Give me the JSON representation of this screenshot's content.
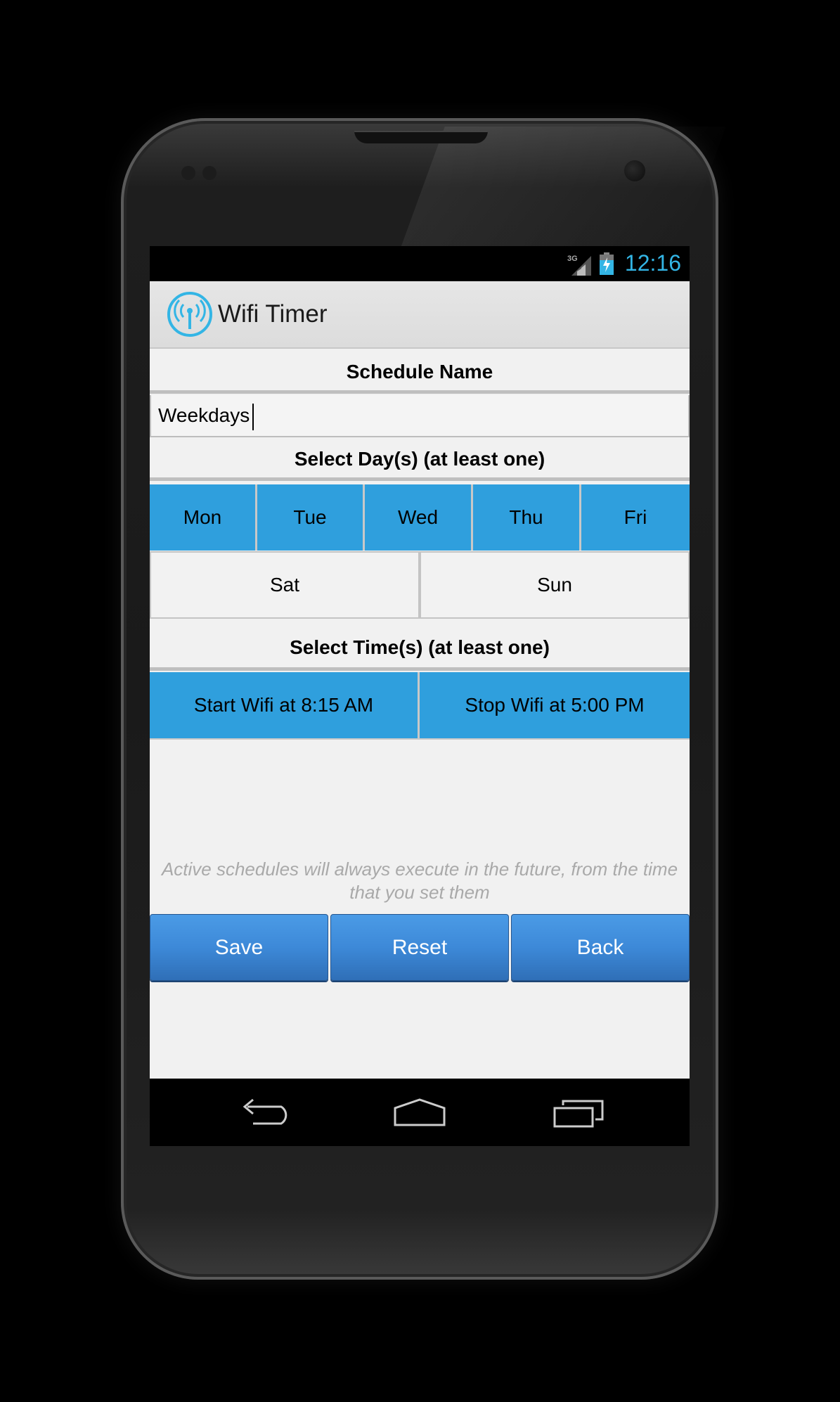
{
  "status_bar": {
    "network": "3G",
    "time": "12:16",
    "accent_color": "#33b5e5"
  },
  "action_bar": {
    "app_icon": "wifi-antenna-icon",
    "title": "Wifi Timer"
  },
  "schedule_name": {
    "label": "Schedule Name",
    "value": "Weekdays"
  },
  "days": {
    "label": "Select Day(s) (at least one)",
    "selected_color": "#2f9fdd",
    "row1": [
      {
        "label": "Mon",
        "selected": true
      },
      {
        "label": "Tue",
        "selected": true
      },
      {
        "label": "Wed",
        "selected": true
      },
      {
        "label": "Thu",
        "selected": true
      },
      {
        "label": "Fri",
        "selected": true
      }
    ],
    "row2": [
      {
        "label": "Sat",
        "selected": false
      },
      {
        "label": "Sun",
        "selected": false
      }
    ]
  },
  "times": {
    "label": "Select Time(s) (at least one)",
    "start": "Start Wifi at 8:15 AM",
    "stop": "Stop Wifi at 5:00 PM"
  },
  "note": "Active schedules will always execute in the future, from the time that you set them",
  "buttons": {
    "save": "Save",
    "reset": "Reset",
    "back": "Back"
  },
  "nav_bar": {
    "back_icon": "back-arrow-icon",
    "home_icon": "home-icon",
    "recents_icon": "recent-apps-icon"
  }
}
